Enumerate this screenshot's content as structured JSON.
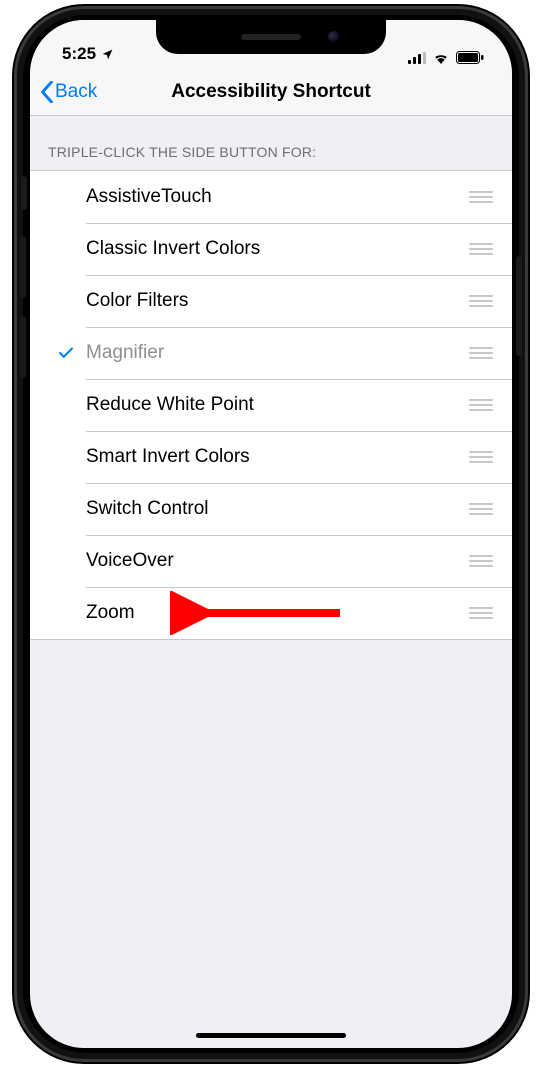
{
  "status": {
    "time": "5:25",
    "location_services": true
  },
  "nav": {
    "back_label": "Back",
    "title": "Accessibility Shortcut"
  },
  "section": {
    "header": "TRIPLE-CLICK THE SIDE BUTTON FOR:"
  },
  "options": [
    {
      "label": "AssistiveTouch",
      "selected": false
    },
    {
      "label": "Classic Invert Colors",
      "selected": false
    },
    {
      "label": "Color Filters",
      "selected": false
    },
    {
      "label": "Magnifier",
      "selected": true
    },
    {
      "label": "Reduce White Point",
      "selected": false
    },
    {
      "label": "Smart Invert Colors",
      "selected": false
    },
    {
      "label": "Switch Control",
      "selected": false
    },
    {
      "label": "VoiceOver",
      "selected": false
    },
    {
      "label": "Zoom",
      "selected": false
    }
  ],
  "annotation": {
    "target_option_index": 8,
    "color": "#ff0000"
  }
}
